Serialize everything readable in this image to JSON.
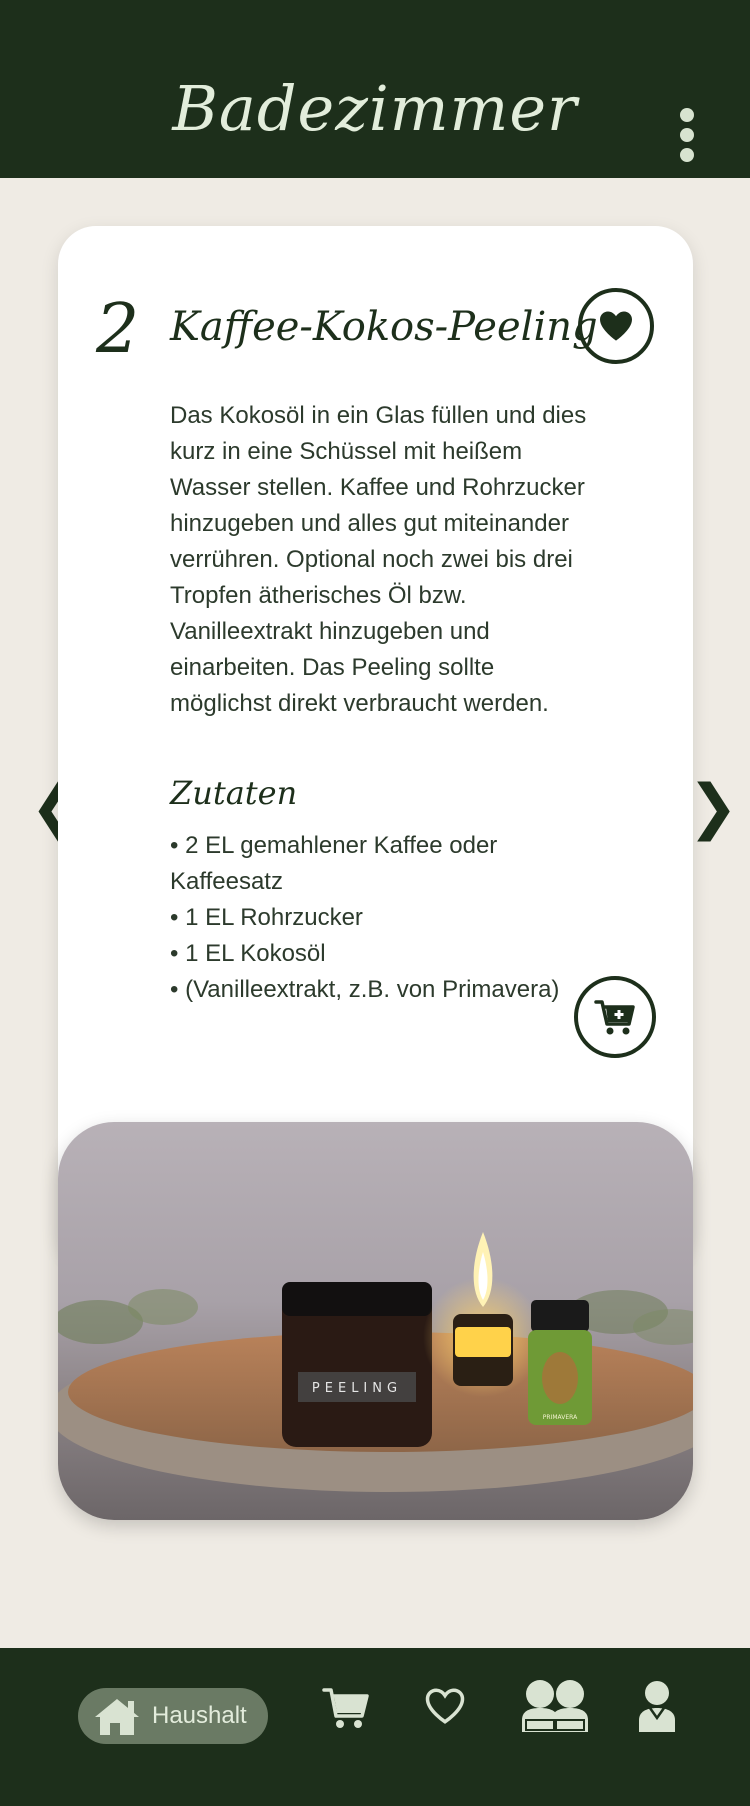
{
  "header": {
    "title": "Badezimmer"
  },
  "recipe": {
    "step": "2",
    "title": "Kaffee-Kokos-Peeling",
    "description": "Das Kokosöl in ein Glas füllen und dies kurz in eine Schüssel mit heißem Wasser stellen. Kaffee und Rohrzucker hinzugeben und alles gut miteinander verrühren. Optional noch zwei bis drei Tropfen ätherisches Öl bzw. Vanilleextrakt hinzugeben und einarbeiten. Das Peeling sollte möglichst direkt verbraucht werden.",
    "ingredients_title": "Zutaten",
    "ingredients": [
      "• 2 EL gemahlener Kaffee oder Kaffeesatz",
      "• 1 EL Rohrzucker",
      "• 1 EL Kokosöl",
      "• (Vanilleextrakt, z.B. von Primavera)"
    ]
  },
  "nav": {
    "prev_glyph": "❮",
    "next_glyph": "❯",
    "home_label": "Haushalt"
  },
  "photo": {
    "jar_label": "PEELING",
    "bottle_label": "PRIMAVERA"
  },
  "icons": [
    "kebab-menu-icon",
    "heart-icon",
    "cart-plus-icon",
    "chevron-left-icon",
    "chevron-right-icon",
    "home-icon",
    "cart-icon",
    "heart-outline-icon",
    "community-icon",
    "profile-icon"
  ],
  "colors": {
    "dark_green": "#1d2f1b",
    "background": "#efebe4",
    "card": "#ffffff",
    "pill": "#6a7a64",
    "light_text": "#e3ecdc"
  }
}
